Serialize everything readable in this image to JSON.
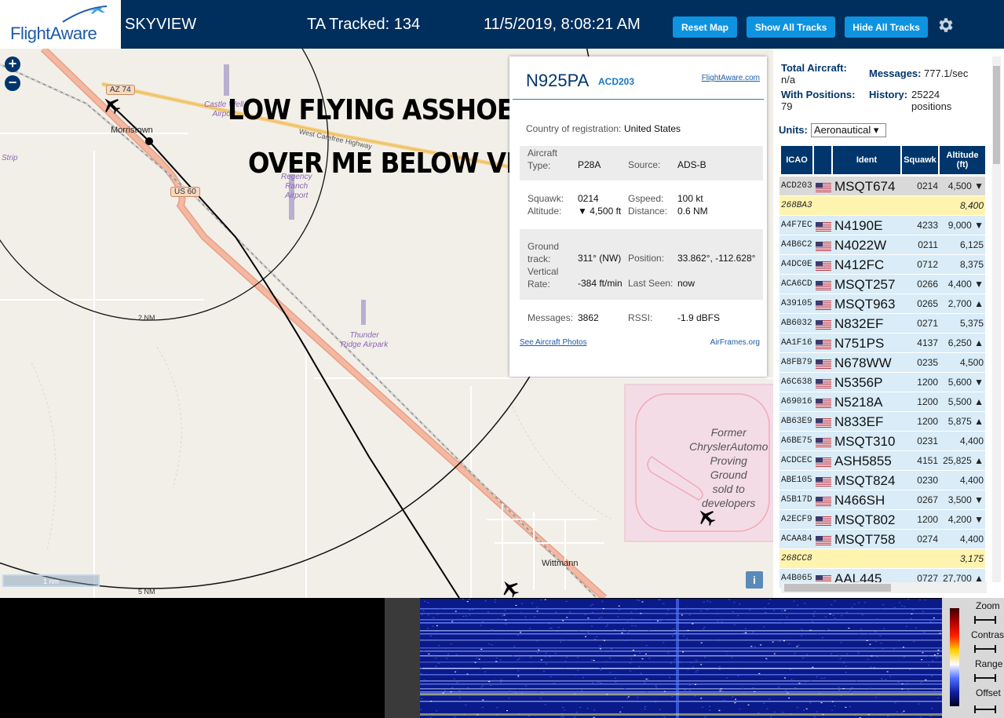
{
  "header": {
    "logo_text": "FlightAware",
    "app_title": "SKYVIEW",
    "tracked": "TA Tracked: 134",
    "datetime": "11/5/2019, 8:08:21 AM",
    "reset_label": "Reset Map",
    "show_label": "Show All Tracks",
    "hide_label": "Hide All Tracks",
    "settings_icon": "gear-icon"
  },
  "map": {
    "zoom_in": "+",
    "zoom_out": "−",
    "overlay_line1": "LOW FLYING ASSHOE",
    "overlay_line2": "OVER ME BELOW VFR",
    "places": {
      "morristown": "Morristown",
      "wittmann": "Wittmann",
      "strip": "Strip",
      "castle_well": "Castle Well\nAirport",
      "regency": "Regency\nRanch\nAirport",
      "thunder": "Thunder\nRidge Airpark",
      "highway": "West Carefree Highway",
      "az74": "AZ 74",
      "us60": "US 60",
      "chrysler": "Former\nChryslerAutomo\nProving\nGround\nsold to\ndevelopers"
    },
    "ring_2nm": "2 NM",
    "ring_5nm": "5 NM",
    "scale": "1 nm",
    "info": "i"
  },
  "popup": {
    "registration": "N925PA",
    "icao": "ACD203",
    "fa_link": "FlightAware.com",
    "country_label": "Country of registration:",
    "country_value": "United States",
    "aircraft_type_label": "Aircraft\nType:",
    "aircraft_type_value": "P28A",
    "source_label": "Source:",
    "source_value": "ADS-B",
    "squawk_label": "Squawk:",
    "squawk_value": "0214",
    "gspeed_label": "Gspeed:",
    "gspeed_value": "100 kt",
    "altitude_label": "Altitude:",
    "altitude_value": "▼ 4,500 ft",
    "distance_label": "Distance:",
    "distance_value": "0.6 NM",
    "track_label": "Ground\ntrack:",
    "track_value": "311° (NW)",
    "position_label": "Position:",
    "position_value": "33.862°, -112.628°",
    "vrate_label": "Vertical\nRate:",
    "vrate_value": "-384 ft/min",
    "lastseen_label": "Last Seen:",
    "lastseen_value": "now",
    "messages_label": "Messages:",
    "messages_value": "3862",
    "rssi_label": "RSSI:",
    "rssi_value": "-1.9 dBFS",
    "photos_link": "See Aircraft Photos",
    "airframes_link": "AirFrames.org"
  },
  "sidebar": {
    "total_label": "Total Aircraft:",
    "total_value": "n/a",
    "messages_label": "Messages:",
    "messages_value": "777.1/sec",
    "withpos_label": "With Positions:",
    "withpos_value": "79",
    "history_label": "History:",
    "history_value": "25224\npositions",
    "units_label": "Units:",
    "units_value": "Aeronautical ▾",
    "columns": [
      "ICAO",
      "",
      "Ident",
      "Squawk",
      "Altitude\n(ft)"
    ],
    "rows": [
      {
        "icao": "ACD203",
        "flag": true,
        "ident": "MSQT674",
        "squawk": "0214",
        "alt": "4,500 ▼",
        "style": "selected"
      },
      {
        "icao": "268BA3",
        "flag": false,
        "ident": "",
        "squawk": "",
        "alt": "8,400",
        "style": "mlat"
      },
      {
        "icao": "A4F7EC",
        "flag": true,
        "ident": "N4190E",
        "squawk": "4233",
        "alt": "9,000 ▼",
        "style": "normal"
      },
      {
        "icao": "A4B6C2",
        "flag": true,
        "ident": "N4022W",
        "squawk": "0211",
        "alt": "6,125",
        "style": "normal"
      },
      {
        "icao": "A4DC0E",
        "flag": true,
        "ident": "N412FC",
        "squawk": "0712",
        "alt": "8,375",
        "style": "normal"
      },
      {
        "icao": "ACA6CD",
        "flag": true,
        "ident": "MSQT257",
        "squawk": "0266",
        "alt": "4,400 ▼",
        "style": "normal"
      },
      {
        "icao": "A39105",
        "flag": true,
        "ident": "MSQT963",
        "squawk": "0265",
        "alt": "2,700 ▲",
        "style": "normal"
      },
      {
        "icao": "AB6032",
        "flag": true,
        "ident": "N832EF",
        "squawk": "0271",
        "alt": "5,375",
        "style": "normal"
      },
      {
        "icao": "AA1F16",
        "flag": true,
        "ident": "N751PS",
        "squawk": "4137",
        "alt": "6,250 ▲",
        "style": "normal"
      },
      {
        "icao": "A8FB79",
        "flag": true,
        "ident": "N678WW",
        "squawk": "0235",
        "alt": "4,500",
        "style": "normal"
      },
      {
        "icao": "A6C638",
        "flag": true,
        "ident": "N5356P",
        "squawk": "1200",
        "alt": "5,600 ▼",
        "style": "normal"
      },
      {
        "icao": "A69016",
        "flag": true,
        "ident": "N5218A",
        "squawk": "1200",
        "alt": "5,500 ▲",
        "style": "normal"
      },
      {
        "icao": "AB63E9",
        "flag": true,
        "ident": "N833EF",
        "squawk": "1200",
        "alt": "5,875 ▲",
        "style": "normal"
      },
      {
        "icao": "A6BE75",
        "flag": true,
        "ident": "MSQT310",
        "squawk": "0231",
        "alt": "4,400",
        "style": "normal"
      },
      {
        "icao": "ACDCEC",
        "flag": true,
        "ident": "ASH5855",
        "squawk": "4151",
        "alt": "25,825 ▲",
        "style": "normal"
      },
      {
        "icao": "ABE105",
        "flag": true,
        "ident": "MSQT824",
        "squawk": "0230",
        "alt": "4,400",
        "style": "normal"
      },
      {
        "icao": "A5B17D",
        "flag": true,
        "ident": "N466SH",
        "squawk": "0267",
        "alt": "3,500 ▼",
        "style": "normal"
      },
      {
        "icao": "A2ECF9",
        "flag": true,
        "ident": "MSQT802",
        "squawk": "1200",
        "alt": "4,200 ▼",
        "style": "normal"
      },
      {
        "icao": "ACAA84",
        "flag": true,
        "ident": "MSQT758",
        "squawk": "0274",
        "alt": "4,400",
        "style": "normal"
      },
      {
        "icao": "268CC8",
        "flag": false,
        "ident": "",
        "squawk": "",
        "alt": "3,175",
        "style": "mlat"
      },
      {
        "icao": "A4B065",
        "flag": true,
        "ident": "AAL445",
        "squawk": "0727",
        "alt": "27,700 ▲",
        "style": "normal"
      }
    ]
  },
  "waterfall": {
    "zoom_label": "Zoom",
    "contrast_label": "Contrast",
    "range_label": "Range",
    "offset_label": "Offset"
  },
  "colors": {
    "header_bg": "#002f5d",
    "button_bg": "#0e93e0",
    "selected_row": "#d9d9d9",
    "mlat_row": "#fff3b0",
    "row_bg": "#d9ecf7",
    "road_major": "#f4a890"
  }
}
